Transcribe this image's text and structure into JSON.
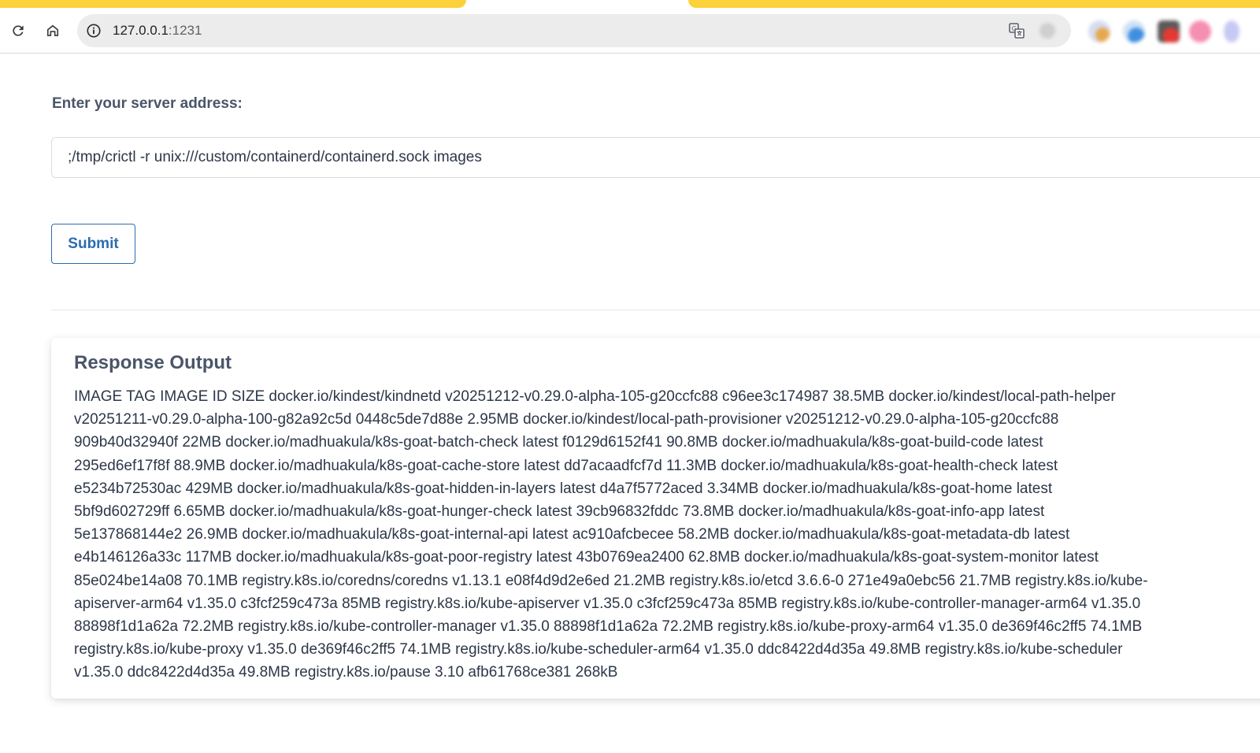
{
  "browser": {
    "url_host": "127.0.0.1",
    "url_port": ":1231"
  },
  "icons": {
    "reload": "reload-icon",
    "home": "home-icon",
    "site_info": "info-icon",
    "translate": "translate-icon"
  },
  "form": {
    "label": "Enter your server address:",
    "input_value": ";/tmp/crictl -r unix:///custom/containerd/containerd.sock images",
    "submit_label": "Submit"
  },
  "response": {
    "title": "Response Output",
    "lines": [
      "IMAGE TAG IMAGE ID SIZE docker.io/kindest/kindnetd v20251212-v0.29.0-alpha-105-g20ccfc88 c96ee3c174987 38.5MB docker.io/kindest/local-path-helper",
      "v20251211-v0.29.0-alpha-100-g82a92c5d 0448c5de7d88e 2.95MB docker.io/kindest/local-path-provisioner v20251212-v0.29.0-alpha-105-g20ccfc88",
      "909b40d32940f 22MB docker.io/madhuakula/k8s-goat-batch-check latest f0129d6152f41 90.8MB docker.io/madhuakula/k8s-goat-build-code latest",
      "295ed6ef17f8f 88.9MB docker.io/madhuakula/k8s-goat-cache-store latest dd7acaadfcf7d 11.3MB docker.io/madhuakula/k8s-goat-health-check latest",
      "e5234b72530ac 429MB docker.io/madhuakula/k8s-goat-hidden-in-layers latest d4a7f5772aced 3.34MB docker.io/madhuakula/k8s-goat-home latest",
      "5bf9d602729ff 6.65MB docker.io/madhuakula/k8s-goat-hunger-check latest 39cb96832fddc 73.8MB docker.io/madhuakula/k8s-goat-info-app latest",
      "5e137868144e2 26.9MB docker.io/madhuakula/k8s-goat-internal-api latest ac910afcbecee 58.2MB docker.io/madhuakula/k8s-goat-metadata-db latest",
      "e4b146126a33c 117MB docker.io/madhuakula/k8s-goat-poor-registry latest 43b0769ea2400 62.8MB docker.io/madhuakula/k8s-goat-system-monitor latest",
      "85e024be14a08 70.1MB registry.k8s.io/coredns/coredns v1.13.1 e08f4d9d2e6ed 21.2MB registry.k8s.io/etcd 3.6.6-0 271e49a0ebc56 21.7MB registry.k8s.io/kube-",
      "apiserver-arm64 v1.35.0 c3fcf259c473a 85MB registry.k8s.io/kube-apiserver v1.35.0 c3fcf259c473a 85MB registry.k8s.io/kube-controller-manager-arm64 v1.35.0",
      "88898f1d1a62a 72.2MB registry.k8s.io/kube-controller-manager v1.35.0 88898f1d1a62a 72.2MB registry.k8s.io/kube-proxy-arm64 v1.35.0 de369f46c2ff5 74.1MB",
      "registry.k8s.io/kube-proxy v1.35.0 de369f46c2ff5 74.1MB registry.k8s.io/kube-scheduler-arm64 v1.35.0 ddc8422d4d35a 49.8MB registry.k8s.io/kube-scheduler",
      "v1.35.0 ddc8422d4d35a 49.8MB registry.k8s.io/pause 3.10 afb61768ce381 268kB"
    ]
  },
  "colors": {
    "tab_accent": "#fdd13a",
    "button_primary": "#2b6cb0",
    "heading": "#4a5568",
    "body_text": "#2d3748"
  }
}
